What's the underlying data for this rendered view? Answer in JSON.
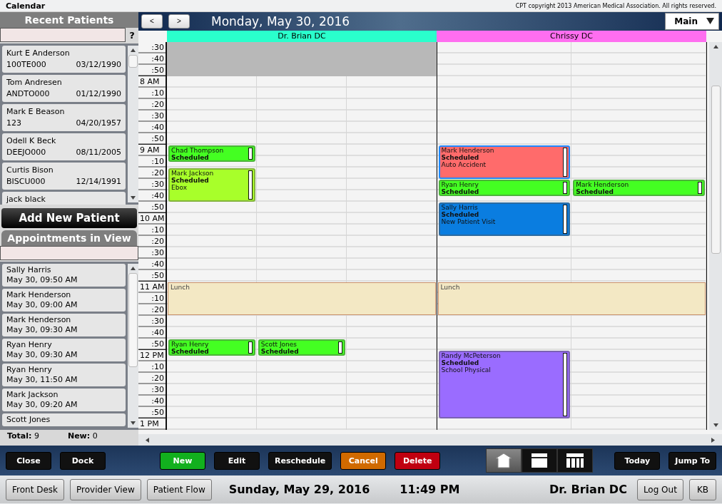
{
  "window": {
    "title": "Calendar",
    "copyright": "CPT copyright 2013 American Medical Association. All rights reserved."
  },
  "recent_patients": {
    "title": "Recent Patients",
    "help": "?",
    "items": [
      {
        "name": "Kurt E Anderson",
        "id": "100TE000",
        "dob": "03/12/1990"
      },
      {
        "name": "Tom Andresen",
        "id": "ANDTO000",
        "dob": "01/12/1990"
      },
      {
        "name": "Mark E Beason",
        "id": "123",
        "dob": "04/20/1957"
      },
      {
        "name": "Odell K Beck",
        "id": "DEEJO000",
        "dob": "08/11/2005"
      },
      {
        "name": "Curtis Bison",
        "id": "BISCU000",
        "dob": "12/14/1991"
      },
      {
        "name": "jack black"
      }
    ]
  },
  "add_patient_button": "Add New Patient",
  "appointments_in_view": {
    "title": "Appointments in View",
    "items": [
      {
        "name": "Sally Harris",
        "time": "May 30, 09:50 AM"
      },
      {
        "name": "Mark Henderson",
        "time": "May 30, 09:00 AM"
      },
      {
        "name": "Mark Henderson",
        "time": "May 30, 09:30 AM"
      },
      {
        "name": "Ryan Henry",
        "time": "May 30, 09:30 AM"
      },
      {
        "name": "Ryan Henry",
        "time": "May 30, 11:50 AM"
      },
      {
        "name": "Mark Jackson",
        "time": "May 30, 09:20 AM"
      },
      {
        "name": "Scott Jones"
      }
    ],
    "total_label": "Total:",
    "total": "9",
    "new_label": "New:",
    "new": "0"
  },
  "calendar": {
    "prev": "<",
    "next": ">",
    "date": "Monday, May 30, 2016",
    "view_select": "Main",
    "times": [
      {
        "label": ":30",
        "kind": "minute"
      },
      {
        "label": ":40",
        "kind": "minute"
      },
      {
        "label": ":50",
        "kind": "minute"
      },
      {
        "label": "8 AM",
        "kind": "hour"
      },
      {
        "label": ":10",
        "kind": "minute"
      },
      {
        "label": ":20",
        "kind": "minute"
      },
      {
        "label": ":30",
        "kind": "minute"
      },
      {
        "label": ":40",
        "kind": "minute"
      },
      {
        "label": ":50",
        "kind": "minute"
      },
      {
        "label": "9 AM",
        "kind": "hour"
      },
      {
        "label": ":10",
        "kind": "minute"
      },
      {
        "label": ":20",
        "kind": "minute"
      },
      {
        "label": ":30",
        "kind": "minute"
      },
      {
        "label": ":40",
        "kind": "minute"
      },
      {
        "label": ":50",
        "kind": "minute"
      },
      {
        "label": "10 AM",
        "kind": "hour"
      },
      {
        "label": ":10",
        "kind": "minute"
      },
      {
        "label": ":20",
        "kind": "minute"
      },
      {
        "label": ":30",
        "kind": "minute"
      },
      {
        "label": ":40",
        "kind": "minute"
      },
      {
        "label": ":50",
        "kind": "minute"
      },
      {
        "label": "11 AM",
        "kind": "hour"
      },
      {
        "label": ":10",
        "kind": "minute"
      },
      {
        "label": ":20",
        "kind": "minute"
      },
      {
        "label": ":30",
        "kind": "minute"
      },
      {
        "label": ":40",
        "kind": "minute"
      },
      {
        "label": ":50",
        "kind": "minute"
      },
      {
        "label": "12 PM",
        "kind": "hour"
      },
      {
        "label": ":10",
        "kind": "minute"
      },
      {
        "label": ":20",
        "kind": "minute"
      },
      {
        "label": ":30",
        "kind": "minute"
      },
      {
        "label": ":40",
        "kind": "minute"
      },
      {
        "label": ":50",
        "kind": "minute"
      },
      {
        "label": "1 PM",
        "kind": "hour"
      }
    ],
    "providers": [
      {
        "name": "Dr. Brian DC",
        "color": "#2affcc",
        "blocks": [
          {
            "kind": "off30"
          },
          {
            "kind": "gap60"
          },
          {
            "kind": "gap60"
          },
          {
            "kind": "gap60"
          },
          {
            "kind": "lunch30",
            "label": "Lunch"
          }
        ],
        "columns": [
          {
            "items": [
              {
                "kind": "gap60"
              },
              {
                "kind": "gap30"
              },
              {
                "kind": "appt15",
                "name": "Chad Thompson",
                "status": "Scheduled",
                "color": "#44ff22",
                "selected": false
              },
              {
                "kind": "gap5"
              },
              {
                "kind": "appt30",
                "name": "Mark Jackson",
                "status": "Scheduled",
                "reason": "Ebox",
                "color": "#a8ff2a",
                "selected": false
              },
              {
                "kind": "gap60"
              },
              {
                "kind": "gap60"
              },
              {
                "kind": "appt15",
                "name": "Ryan Henry",
                "status": "Scheduled",
                "color": "#44ff22",
                "selected": false
              }
            ]
          },
          {
            "items": [
              {
                "kind": "gap60"
              },
              {
                "kind": "gap60"
              },
              {
                "kind": "gap60"
              },
              {
                "kind": "gap60"
              },
              {
                "kind": "gap10"
              },
              {
                "kind": "gap10"
              },
              {
                "kind": "appt15",
                "name": "Scott Jones",
                "status": "Scheduled",
                "color": "#44ff22",
                "selected": false
              }
            ]
          },
          {}
        ]
      },
      {
        "name": "Chrissy DC",
        "color": "#ff6ef0",
        "blocks": [
          {
            "kind": "gap60"
          },
          {
            "kind": "gap60"
          },
          {
            "kind": "gap60"
          },
          {
            "kind": "gap30"
          },
          {
            "kind": "lunch30",
            "label": "Lunch"
          }
        ],
        "columns": [
          {
            "items": [
              {
                "kind": "gap60"
              },
              {
                "kind": "gap30"
              },
              {
                "kind": "appt30",
                "name": "Mark Henderson",
                "status": "Scheduled",
                "reason": "Auto Accident",
                "color": "#ff6b6b",
                "selected": true
              },
              {
                "kind": "appt15",
                "name": "Ryan Henry",
                "status": "Scheduled",
                "color": "#44ff22",
                "selected": false
              },
              {
                "kind": "gap5"
              },
              {
                "kind": "appt30",
                "name": "Sally Harris",
                "status": "Scheduled",
                "reason": "New Patient Visit",
                "color": "#0a7de0",
                "selected": false
              },
              {
                "kind": "gap60"
              },
              {
                "kind": "gap30"
              },
              {
                "kind": "gap10"
              },
              {
                "kind": "appt60",
                "name": "Randy McPeterson",
                "status": "Scheduled",
                "reason": "School Physical",
                "color": "#9a6cff",
                "selected": false
              }
            ]
          },
          {
            "items": [
              {
                "kind": "gap60"
              },
              {
                "kind": "gap60"
              },
              {
                "kind": "appt15",
                "name": "Mark Henderson",
                "status": "Scheduled",
                "color": "#44ff22",
                "selected": false
              }
            ]
          }
        ]
      }
    ]
  },
  "toolbar": {
    "left": [
      {
        "label": "Close",
        "color": "#111111"
      },
      {
        "label": "Dock",
        "color": "#111111"
      }
    ],
    "actions": [
      {
        "label": "New",
        "color": "#12b01e"
      },
      {
        "label": "Edit",
        "color": "#111111"
      },
      {
        "label": "Reschedule",
        "color": "#111111"
      },
      {
        "label": "Cancel",
        "color": "#d06a00"
      },
      {
        "label": "Delete",
        "color": "#c00010"
      }
    ],
    "views": [
      {
        "kind": "home",
        "selected": true
      },
      {
        "kind": "day",
        "selected": false
      },
      {
        "kind": "week",
        "selected": false
      }
    ],
    "right": [
      {
        "label": "Today",
        "color": "#111111"
      },
      {
        "label": "Jump To",
        "color": "#111111"
      }
    ]
  },
  "status_bar": {
    "buttons": [
      "Front Desk",
      "Provider View",
      "Patient Flow"
    ],
    "date": "Sunday, May 29, 2016",
    "time": "11:49 PM",
    "user": "Dr. Brian DC",
    "logout": "Log Out",
    "kb": "KB"
  }
}
